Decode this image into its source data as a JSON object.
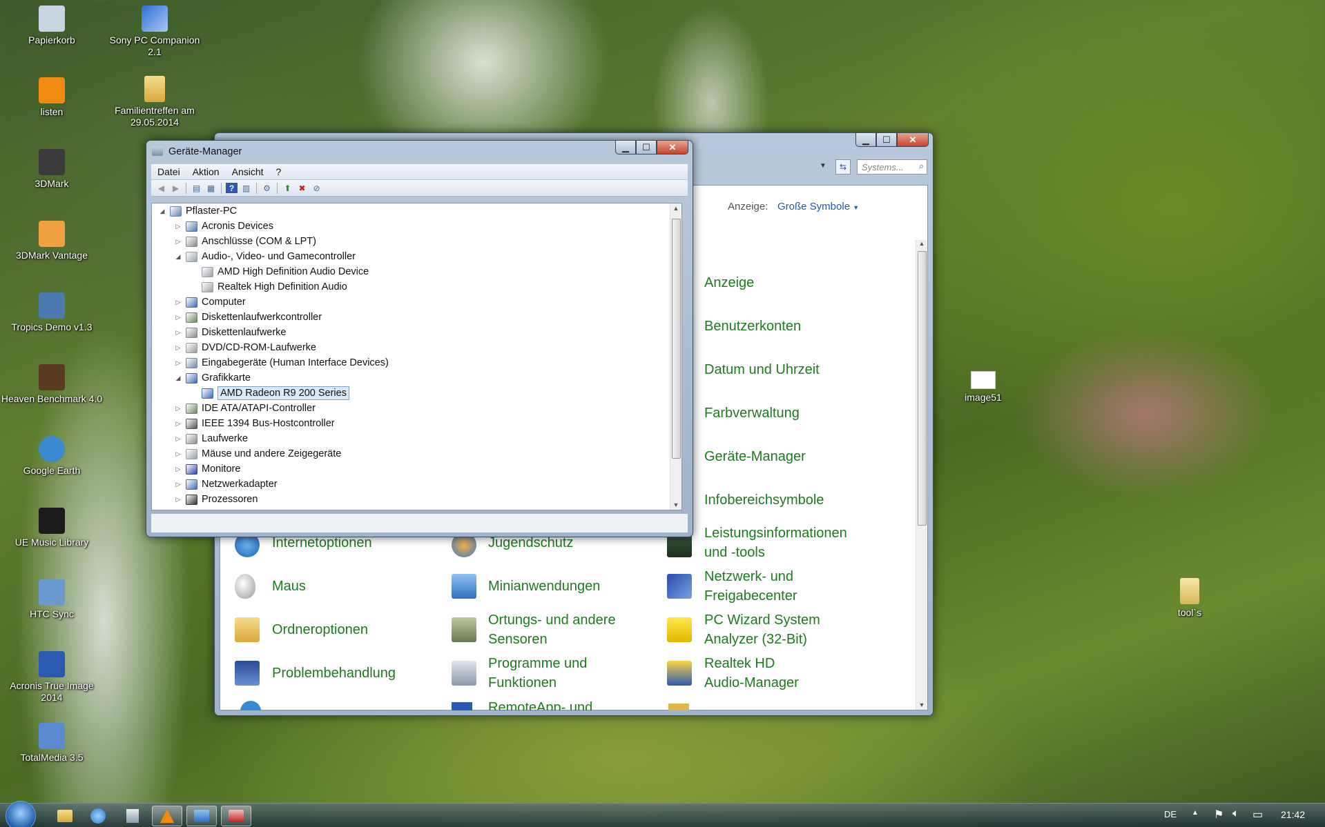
{
  "desktop": {
    "icons_left": [
      {
        "label": "Papierkorb",
        "icon": "recycle-bin-icon"
      },
      {
        "label": "listen",
        "icon": "vlc-icon"
      },
      {
        "label": "3DMark",
        "icon": "3dmark-icon"
      },
      {
        "label": "3DMark Vantage",
        "icon": "3dmark-vantage-icon"
      },
      {
        "label": "Tropics Demo v1.3",
        "icon": "tropics-demo-icon"
      },
      {
        "label": "Heaven Benchmark 4.0",
        "icon": "heaven-benchmark-icon"
      },
      {
        "label": "Google Earth",
        "icon": "google-earth-icon"
      },
      {
        "label": "UE Music Library",
        "icon": "ue-music-icon"
      },
      {
        "label": "HTC Sync",
        "icon": "htc-sync-icon"
      },
      {
        "label": "Acronis True Image 2014",
        "icon": "acronis-icon"
      },
      {
        "label": "TotalMedia 3.5",
        "icon": "totalmedia-icon"
      }
    ],
    "icons_col2": [
      {
        "label": "Sony PC Companion 2.1",
        "icon": "sony-pc-companion-icon"
      },
      {
        "label": "Familientreffen am 29.05.2014",
        "icon": "folder-icon"
      }
    ],
    "icon_image51": "image51",
    "icon_tools": "tool`s"
  },
  "control_panel": {
    "search_placeholder": "Systems...",
    "view_label": "Anzeige:",
    "view_value": "Große Symbole",
    "col3_items": [
      "Anzeige",
      "Benutzerkonten",
      "Datum und Uhrzeit",
      "Farbverwaltung",
      "Geräte-Manager",
      "Infobereichsymbole"
    ],
    "rows": [
      {
        "c1": "Internetoptionen",
        "c2": "Jugendschutz",
        "c3a": "Leistungsinformationen",
        "c3b": "und -tools"
      },
      {
        "c1": "Maus",
        "c2": "Minianwendungen",
        "c3a": "Netzwerk- und",
        "c3b": "Freigabecenter"
      },
      {
        "c1": "Ordneroptionen",
        "c2a": "Ortungs- und andere",
        "c2b": "Sensoren",
        "c3a": "PC Wizard System",
        "c3b": "Analyzer (32-Bit)"
      },
      {
        "c1": "Problembehandlung",
        "c2a": "Programme und",
        "c2b": "Funktionen",
        "c3a": "Realtek HD",
        "c3b": "Audio-Manager"
      },
      {
        "c2": "RemoteApp- und"
      }
    ]
  },
  "device_manager": {
    "title": "Geräte-Manager",
    "menu": [
      "Datei",
      "Aktion",
      "Ansicht",
      "?"
    ],
    "tree": [
      {
        "label": "Pflaster-PC",
        "level": 0,
        "state": "open",
        "color": "#5f84b4"
      },
      {
        "label": "Acronis Devices",
        "level": 1,
        "state": "closed",
        "color": "#4c78b0"
      },
      {
        "label": "Anschlüsse (COM & LPT)",
        "level": 1,
        "state": "closed",
        "color": "#8a8a8a"
      },
      {
        "label": "Audio-, Video- und Gamecontroller",
        "level": 1,
        "state": "open",
        "color": "#9aa0a8"
      },
      {
        "label": "AMD High Definition Audio Device",
        "level": 2,
        "state": "leaf",
        "color": "#9aa0a8"
      },
      {
        "label": "Realtek High Definition Audio",
        "level": 2,
        "state": "leaf",
        "color": "#9aa0a8"
      },
      {
        "label": "Computer",
        "level": 1,
        "state": "closed",
        "color": "#3b6cc0"
      },
      {
        "label": "Diskettenlaufwerkcontroller",
        "level": 1,
        "state": "closed",
        "color": "#6a8a5a"
      },
      {
        "label": "Diskettenlaufwerke",
        "level": 1,
        "state": "closed",
        "color": "#8a8a8a"
      },
      {
        "label": "DVD/CD-ROM-Laufwerke",
        "level": 1,
        "state": "closed",
        "color": "#9a9a9a"
      },
      {
        "label": "Eingabegeräte (Human Interface Devices)",
        "level": 1,
        "state": "closed",
        "color": "#6a8aa8"
      },
      {
        "label": "Grafikkarte",
        "level": 1,
        "state": "open",
        "color": "#3b6cc0"
      },
      {
        "label": "AMD Radeon R9 200 Series",
        "level": 2,
        "state": "leaf",
        "color": "#3b6cc0",
        "selected": true
      },
      {
        "label": "IDE ATA/ATAPI-Controller",
        "level": 1,
        "state": "closed",
        "color": "#6a8a5a"
      },
      {
        "label": "IEEE 1394 Bus-Hostcontroller",
        "level": 1,
        "state": "closed",
        "color": "#555555"
      },
      {
        "label": "Laufwerke",
        "level": 1,
        "state": "closed",
        "color": "#8a8a8a"
      },
      {
        "label": "Mäuse und andere Zeigegeräte",
        "level": 1,
        "state": "closed",
        "color": "#9aa0a8"
      },
      {
        "label": "Monitore",
        "level": 1,
        "state": "closed",
        "color": "#2a4aa8"
      },
      {
        "label": "Netzwerkadapter",
        "level": 1,
        "state": "closed",
        "color": "#3b6cc0"
      },
      {
        "label": "Prozessoren",
        "level": 1,
        "state": "closed",
        "color": "#333333"
      }
    ]
  },
  "taskbar": {
    "language": "DE",
    "clock": "21:42"
  }
}
